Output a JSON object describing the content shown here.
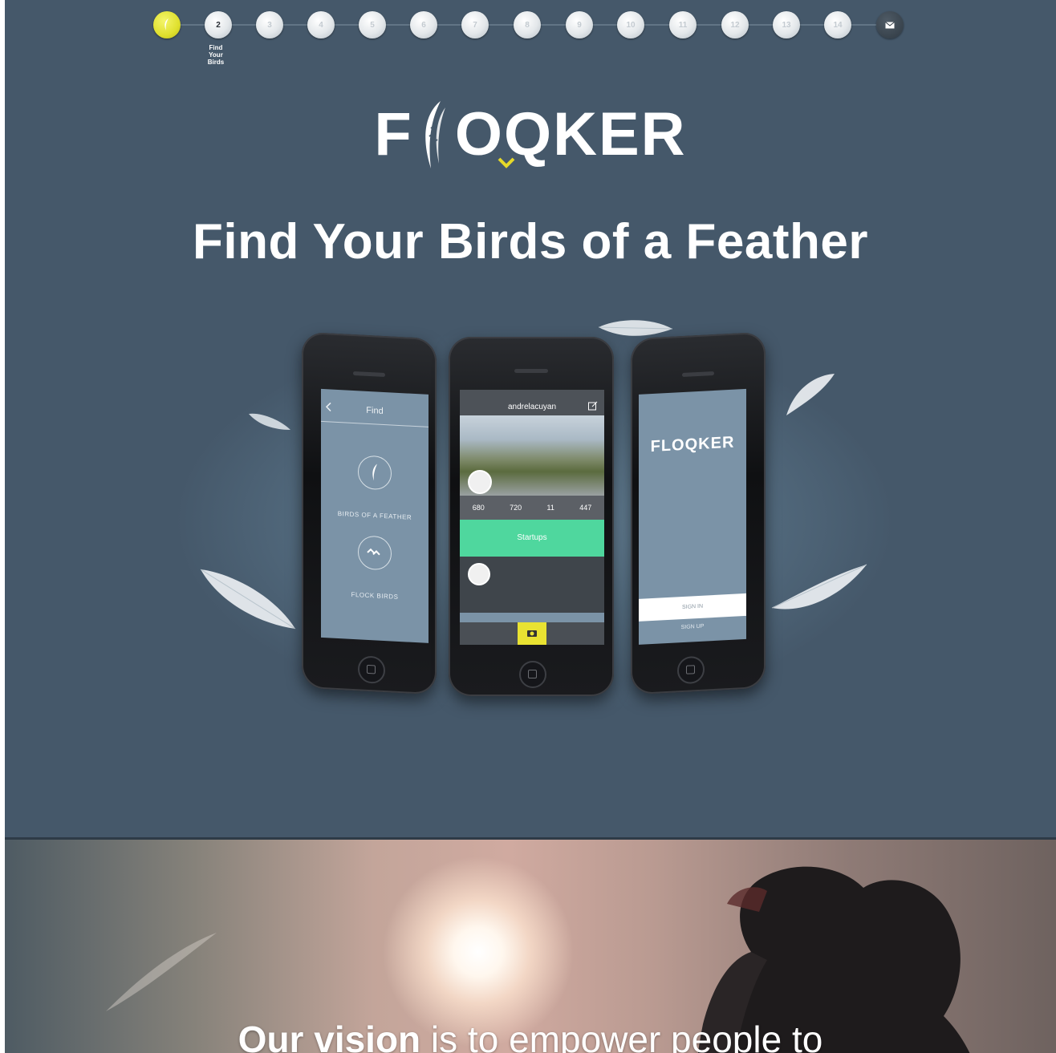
{
  "nav": {
    "steps": [
      "",
      "2",
      "3",
      "4",
      "5",
      "6",
      "7",
      "8",
      "9",
      "10",
      "11",
      "12",
      "13",
      "14",
      ""
    ],
    "current_label": "Find Your Birds",
    "active_color": "#dfe02e",
    "last_icon": "mail-icon"
  },
  "logo": {
    "text_left": "F",
    "text_right": "OQKER"
  },
  "headline": "Find Your Birds of a Feather",
  "phones": {
    "left": {
      "title": "Find",
      "option1": "BIRDS OF A FEATHER",
      "option2": "FLOCK BIRDS"
    },
    "center": {
      "username": "andrelacuyan",
      "stats": [
        "680",
        "720",
        "11",
        "447"
      ],
      "section": "Startups",
      "accent_color": "#4fd79e"
    },
    "right": {
      "logo": "FLOQKER",
      "signin": "SIGN IN",
      "signup": "SIGN UP"
    }
  },
  "vision": {
    "bold": "Our vision",
    "rest": " is to empower people to"
  }
}
